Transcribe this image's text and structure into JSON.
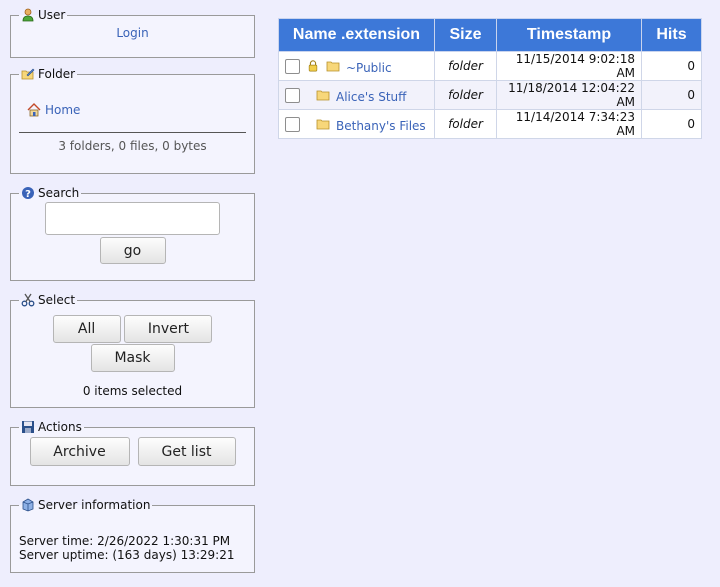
{
  "user": {
    "legend": "User",
    "login": "Login"
  },
  "folder": {
    "legend": "Folder",
    "home": "Home",
    "stats": "3 folders, 0 files, 0 bytes"
  },
  "search": {
    "legend": "Search",
    "placeholder": "",
    "go": "go"
  },
  "select": {
    "legend": "Select",
    "all": "All",
    "invert": "Invert",
    "mask": "Mask",
    "status": "0 items selected"
  },
  "actions": {
    "legend": "Actions",
    "archive": "Archive",
    "getlist": "Get list"
  },
  "server": {
    "legend": "Server information",
    "time": "Server time: 2/26/2022 1:30:31 PM",
    "uptime": "Server uptime: (163 days) 13:29:21"
  },
  "table": {
    "headers": [
      "Name .extension",
      "Size",
      "Timestamp",
      "Hits"
    ],
    "rows": [
      {
        "name": "~Public",
        "size": "folder",
        "timestamp": "11/15/2014 9:02:18 AM",
        "hits": "0",
        "locked": true
      },
      {
        "name": "Alice's Stuff",
        "size": "folder",
        "timestamp": "11/18/2014 12:04:22 AM",
        "hits": "0",
        "locked": false
      },
      {
        "name": "Bethany's Files",
        "size": "folder",
        "timestamp": "11/14/2014 7:34:23 AM",
        "hits": "0",
        "locked": false
      }
    ]
  },
  "colors": {
    "header": "#3d78d8",
    "page": "#eeeefd",
    "link": "#3a63b8"
  }
}
